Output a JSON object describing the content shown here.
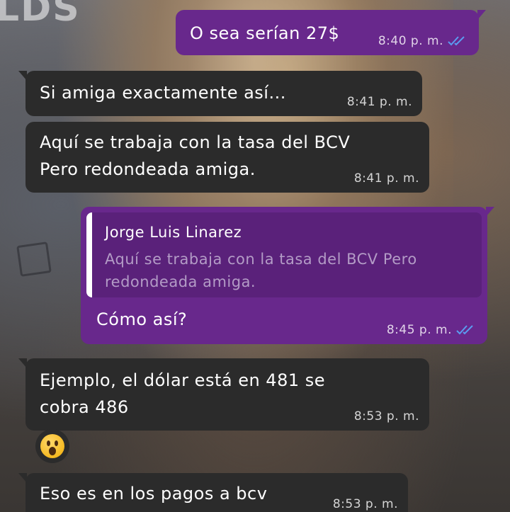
{
  "wallpaper": {
    "logo_text": "LDS"
  },
  "messages": [
    {
      "type": "outgoing",
      "text": "O sea serían 27$",
      "time": "8:40 p. m.",
      "status": "read"
    },
    {
      "type": "incoming",
      "text": "Si amiga exactamente así...",
      "time": "8:41 p. m."
    },
    {
      "type": "incoming",
      "line1": "Aquí se trabaja con la tasa del BCV",
      "line2": "Pero redondeada amiga.",
      "time": "8:41 p. m."
    },
    {
      "type": "outgoing",
      "reply": {
        "author": "Jorge Luis Linarez",
        "line1": "Aquí se trabaja con la tasa del BCV Pero",
        "line2": "redondeada amiga."
      },
      "text": "Cómo así?",
      "time": "8:45 p. m.",
      "status": "read"
    },
    {
      "type": "incoming",
      "line1": "Ejemplo, el dólar está en 481 se",
      "line2": "cobra 486",
      "time": "8:53 p. m.",
      "reaction": "surprised-face-emoji"
    },
    {
      "type": "incoming",
      "text": "Eso es en los pagos a bcv",
      "time": "8:53 p. m."
    }
  ],
  "colors": {
    "incoming_bubble": "#2b2b2b",
    "outgoing_bubble": "#68288c",
    "read_ticks": "#5b9cf0"
  }
}
